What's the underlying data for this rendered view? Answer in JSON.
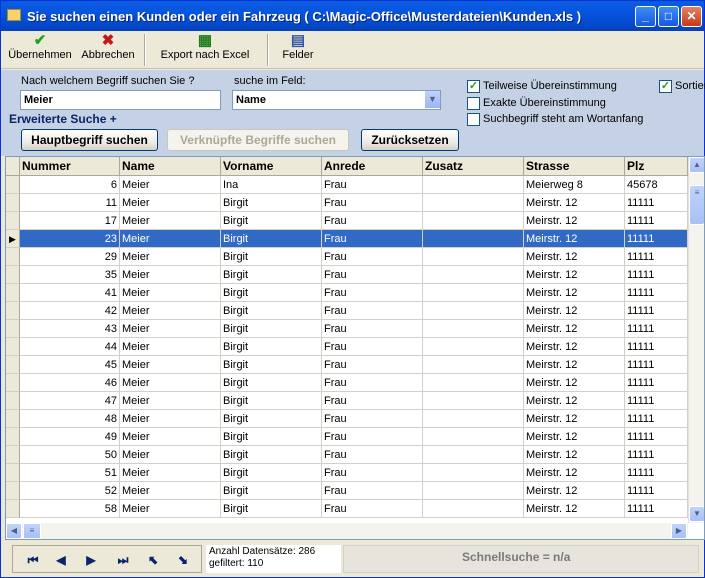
{
  "window": {
    "title": "Sie suchen einen Kunden oder ein Fahrzeug ( C:\\Magic-Office\\Musterdateien\\Kunden.xls )"
  },
  "toolbar": {
    "accept_label": "Übernehmen",
    "cancel_label": "Abbrechen",
    "export_label": "Export nach Excel",
    "fields_label": "Felder"
  },
  "search": {
    "term_label": "Nach welchem Begriff suchen Sie ?",
    "term_value": "Meier",
    "field_label": "suche im Feld:",
    "field_value": "Name",
    "extended_label": "Erweiterte Suche +",
    "partial_match_label": "Teilweise Übereinstimmung",
    "exact_match_label": "Exakte Übereinstimmung",
    "word_start_label": "Suchbegriff steht am Wortanfang",
    "sort_label": "Sortier",
    "main_search_button": "Hauptbegriff suchen",
    "linked_search_button": "Verknüpfte Begriffe suchen",
    "reset_button": "Zurücksetzen"
  },
  "grid": {
    "columns": [
      "Nummer",
      "Name",
      "Vorname",
      "Anrede",
      "Zusatz",
      "Strasse",
      "Plz"
    ],
    "rows": [
      [
        "6",
        "Meier",
        "Ina",
        "Frau",
        "",
        "Meierweg 8",
        "45678"
      ],
      [
        "11",
        "Meier",
        "Birgit",
        "Frau",
        "",
        "Meirstr. 12",
        "11111"
      ],
      [
        "17",
        "Meier",
        "Birgit",
        "Frau",
        "",
        "Meirstr. 12",
        "11111"
      ],
      [
        "23",
        "Meier",
        "Birgit",
        "Frau",
        "",
        "Meirstr. 12",
        "11111"
      ],
      [
        "29",
        "Meier",
        "Birgit",
        "Frau",
        "",
        "Meirstr. 12",
        "11111"
      ],
      [
        "35",
        "Meier",
        "Birgit",
        "Frau",
        "",
        "Meirstr. 12",
        "11111"
      ],
      [
        "41",
        "Meier",
        "Birgit",
        "Frau",
        "",
        "Meirstr. 12",
        "11111"
      ],
      [
        "42",
        "Meier",
        "Birgit",
        "Frau",
        "",
        "Meirstr. 12",
        "11111"
      ],
      [
        "43",
        "Meier",
        "Birgit",
        "Frau",
        "",
        "Meirstr. 12",
        "11111"
      ],
      [
        "44",
        "Meier",
        "Birgit",
        "Frau",
        "",
        "Meirstr. 12",
        "11111"
      ],
      [
        "45",
        "Meier",
        "Birgit",
        "Frau",
        "",
        "Meirstr. 12",
        "11111"
      ],
      [
        "46",
        "Meier",
        "Birgit",
        "Frau",
        "",
        "Meirstr. 12",
        "11111"
      ],
      [
        "47",
        "Meier",
        "Birgit",
        "Frau",
        "",
        "Meirstr. 12",
        "11111"
      ],
      [
        "48",
        "Meier",
        "Birgit",
        "Frau",
        "",
        "Meirstr. 12",
        "11111"
      ],
      [
        "49",
        "Meier",
        "Birgit",
        "Frau",
        "",
        "Meirstr. 12",
        "11111"
      ],
      [
        "50",
        "Meier",
        "Birgit",
        "Frau",
        "",
        "Meirstr. 12",
        "11111"
      ],
      [
        "51",
        "Meier",
        "Birgit",
        "Frau",
        "",
        "Meirstr. 12",
        "11111"
      ],
      [
        "52",
        "Meier",
        "Birgit",
        "Frau",
        "",
        "Meirstr. 12",
        "11111"
      ],
      [
        "58",
        "Meier",
        "Birgit",
        "Frau",
        "",
        "Meirstr. 12",
        "11111"
      ]
    ],
    "selected_row": 3
  },
  "status": {
    "record_count": "Anzahl Datensätze: 286",
    "filtered": "gefiltert: 110",
    "quick_search": "Schnellsuche = n/a"
  }
}
